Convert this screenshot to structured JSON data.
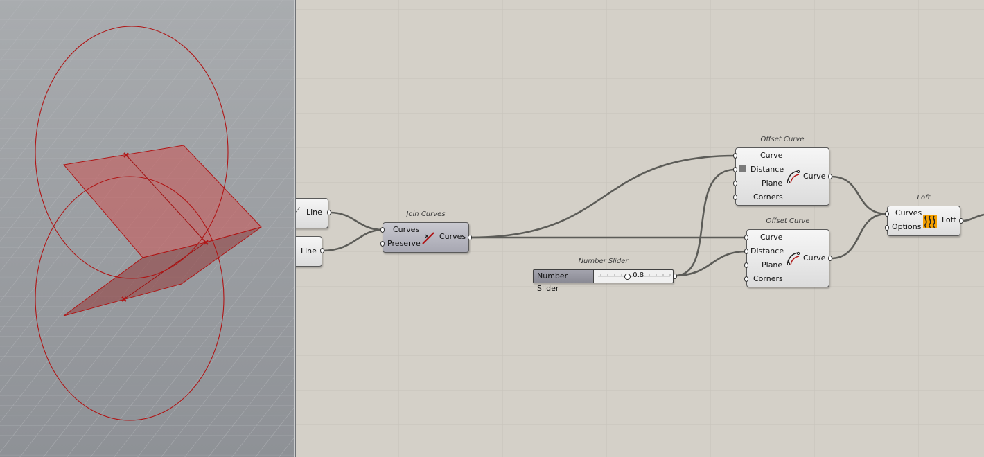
{
  "viewport": {
    "label": "Rhino 3D viewport",
    "geometry_color": "#b01515"
  },
  "components": {
    "line1": {
      "label": "Line"
    },
    "line2": {
      "label": "Line"
    },
    "join_curves": {
      "title": "Join Curves",
      "inputs": [
        "Curves",
        "Preserve"
      ],
      "output": "Curves"
    },
    "offset1": {
      "title": "Offset Curve",
      "inputs": [
        "Curve",
        "Distance",
        "Plane",
        "Corners"
      ],
      "output": "Curve"
    },
    "offset2": {
      "title": "Offset Curve",
      "inputs": [
        "Curve",
        "Distance",
        "Plane",
        "Corners"
      ],
      "output": "Curve"
    },
    "slider": {
      "title": "Number Slider",
      "label": "Number Slider",
      "value": "0.8"
    },
    "loft": {
      "title": "Loft",
      "inputs": [
        "Curves",
        "Options"
      ],
      "output": "Loft"
    }
  },
  "colors": {
    "canvas": "#d4d0c8",
    "wire": "#5c5c58",
    "loft_icon": "#f5a000"
  }
}
